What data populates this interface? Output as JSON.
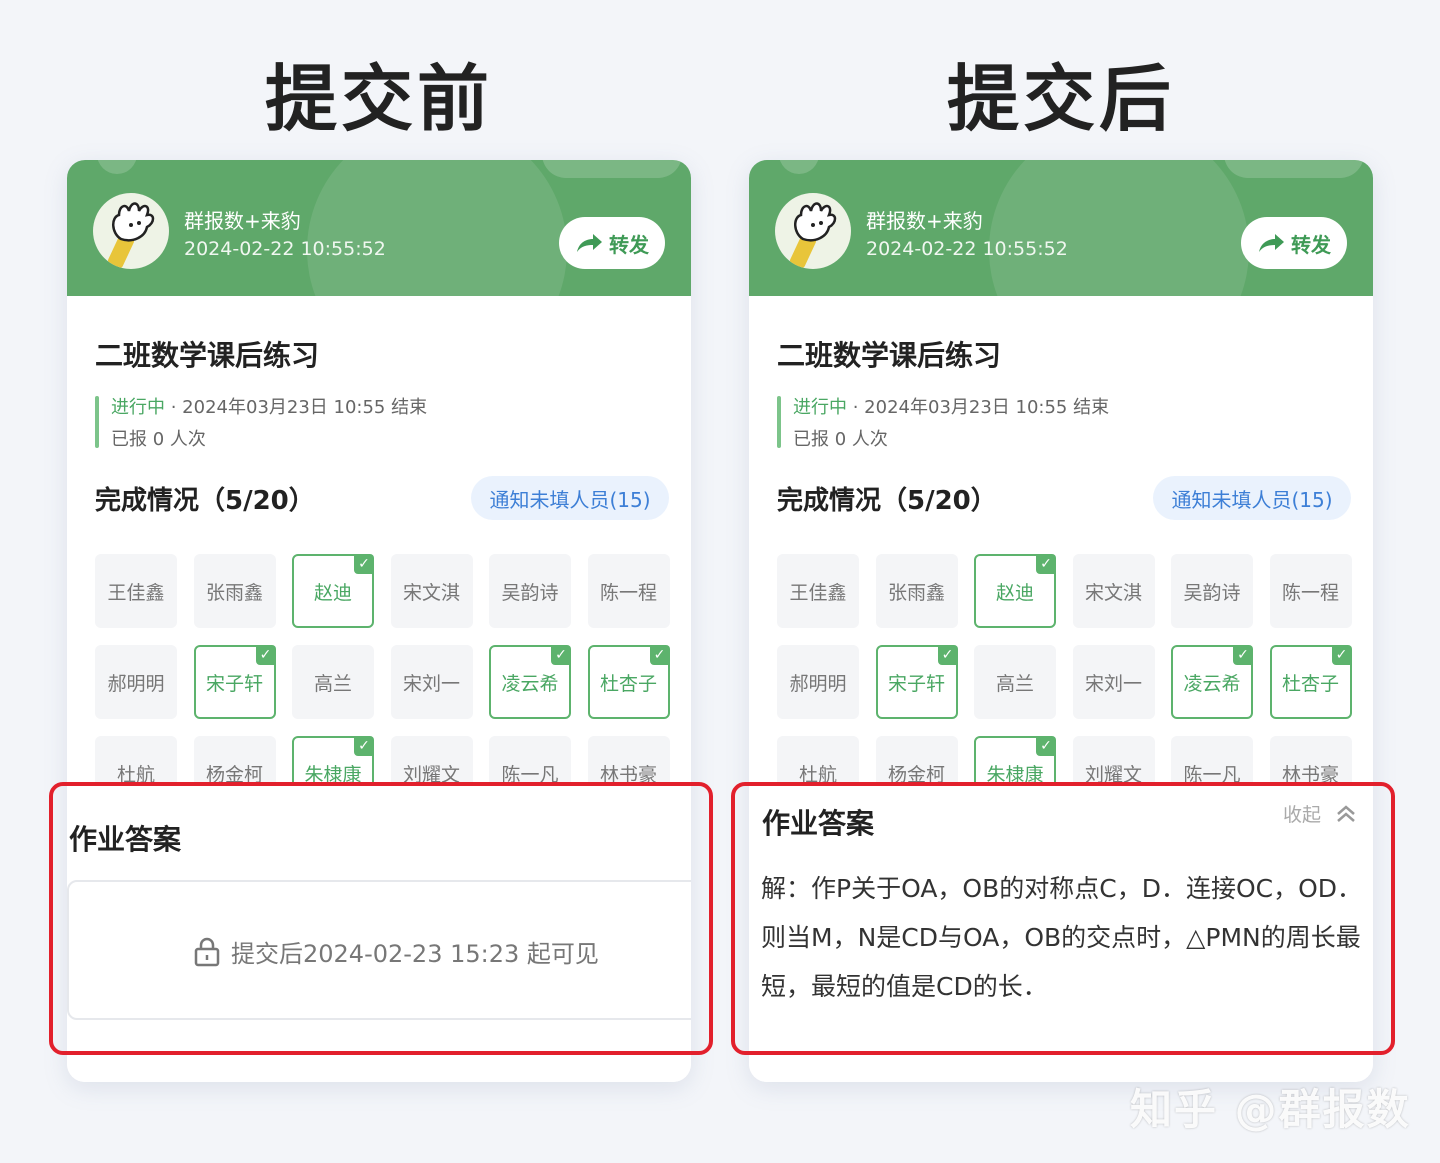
{
  "before": {
    "column_title": "提交前",
    "header": {
      "group_name": "群报数+来豹",
      "datetime": "2024-02-22 10:55:52",
      "share_label": "转发"
    },
    "task_title": "二班数学课后练习",
    "status": {
      "state": "进行中",
      "deadline": "· 2024年03月23日 10:55 结束",
      "reported": "已报 0 人次"
    },
    "completion": {
      "title": "完成情况（5/20）",
      "notify_label": "通知未填人员(15)"
    },
    "answer": {
      "title": "作业答案",
      "lock_text": "提交后2024-02-23 15:23 起可见"
    }
  },
  "after": {
    "column_title": "提交后",
    "header": {
      "group_name": "群报数+来豹",
      "datetime": "2024-02-22 10:55:52",
      "share_label": "转发"
    },
    "task_title": "二班数学课后练习",
    "status": {
      "state": "进行中",
      "deadline": "· 2024年03月23日 10:55 结束",
      "reported": "已报 0 人次"
    },
    "completion": {
      "title": "完成情况（5/20）",
      "notify_label": "通知未填人员(15)"
    },
    "answer": {
      "title": "作业答案",
      "collapse_label": "收起",
      "solution": "解：作P关于OA，OB的对称点C，D．连接OC，OD．则当M，N是CD与OA，OB的交点时，△PMN的周长最短，最短的值是CD的长．"
    }
  },
  "students": [
    {
      "name": "王佳鑫",
      "done": false
    },
    {
      "name": "张雨鑫",
      "done": false
    },
    {
      "name": "赵迪",
      "done": true
    },
    {
      "name": "宋文淇",
      "done": false
    },
    {
      "name": "吴韵诗",
      "done": false
    },
    {
      "name": "陈一程",
      "done": false
    },
    {
      "name": "郝明明",
      "done": false
    },
    {
      "name": "宋子轩",
      "done": true
    },
    {
      "name": "高兰",
      "done": false
    },
    {
      "name": "宋刘一",
      "done": false
    },
    {
      "name": "凌云希",
      "done": true
    },
    {
      "name": "杜杏子",
      "done": true
    },
    {
      "name": "杜航",
      "done": false
    },
    {
      "name": "杨金柯",
      "done": false
    },
    {
      "name": "朱棣康",
      "done": true
    },
    {
      "name": "刘耀文",
      "done": false
    },
    {
      "name": "陈一凡",
      "done": false
    },
    {
      "name": "林书豪",
      "done": false
    }
  ],
  "watermark": "知乎 @群报数",
  "colors": {
    "brand_green": "#5fa86a",
    "check_green": "#5db36d",
    "highlight_red": "#e2202c",
    "notify_blue": "#3d7fd6"
  }
}
